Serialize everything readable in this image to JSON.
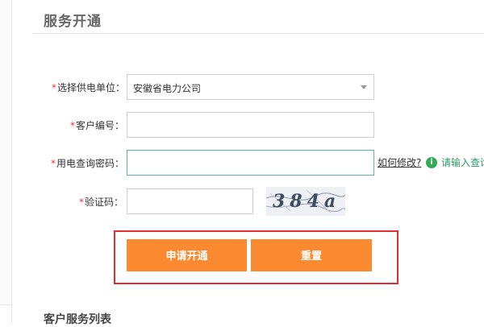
{
  "section_title": "服务开通",
  "form": {
    "required_mark": "*",
    "supplier": {
      "label": "选择供电单位：",
      "selected": "安徽省电力公司"
    },
    "customer_no": {
      "label": "客户编号：",
      "value": ""
    },
    "query_password": {
      "label": "用电查询密码：",
      "value": "",
      "help_link": "如何修改?",
      "hint": "请输入查询"
    },
    "captcha": {
      "label": "验证码：",
      "value": "",
      "image_text": "384a"
    }
  },
  "buttons": {
    "apply": "申请开通",
    "reset": "重置"
  },
  "bottom_title": "客户服务列表",
  "colors": {
    "accent": "#fb8930",
    "required": "#e4393c",
    "hint": "#2b9a64",
    "highlight": "#e02d2d"
  }
}
